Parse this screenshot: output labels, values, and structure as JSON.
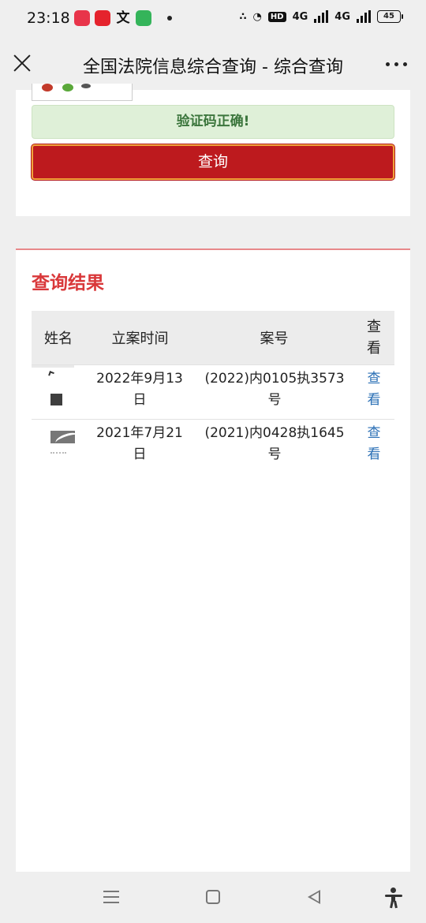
{
  "status_bar": {
    "time": "23:18",
    "app_icons": [
      "pinduoduo-icon",
      "huige-news-icon",
      "wen-icon",
      "messages-icon"
    ],
    "wen_glyph": "文",
    "network": "4G",
    "network2": "4G",
    "hd": "HD",
    "battery": "45"
  },
  "nav": {
    "title": "全国法院信息综合查询 - 综合查询"
  },
  "form": {
    "verify_message": "验证码正确!",
    "query_button": "查询"
  },
  "results": {
    "title": "查询结果",
    "columns": {
      "name": "姓名",
      "date": "立案时间",
      "case": "案号",
      "view": "查看"
    },
    "rows": [
      {
        "date": "2022年9月13日",
        "case": "(2022)内0105执3573号",
        "view": "查看"
      },
      {
        "date": "2021年7月21日",
        "case": "(2021)内0428执1645号",
        "view": "查看"
      }
    ]
  },
  "colors": {
    "accent_red": "#bd1a1e",
    "title_red": "#d9383a",
    "success_green": "#3c763d",
    "link_blue": "#2a6fb5"
  }
}
